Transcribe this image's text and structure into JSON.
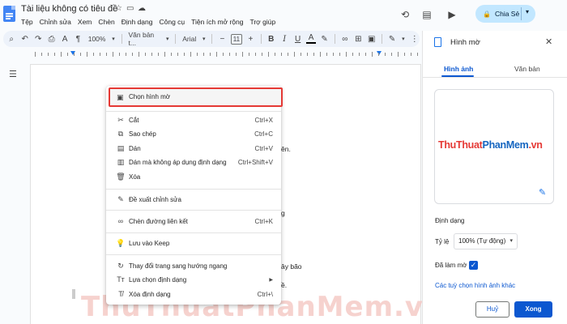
{
  "app": {
    "doc_title": "Tài liệu không có tiêu đề",
    "menus": [
      "Tệp",
      "Chỉnh sửa",
      "Xem",
      "Chèn",
      "Định dạng",
      "Công cụ",
      "Tiện ích mở rộng",
      "Trợ giúp"
    ],
    "share_label": "Chia Sẻ"
  },
  "toolbar": {
    "zoom": "100%",
    "style": "Văn bản t...",
    "font": "Arial",
    "font_size": "11"
  },
  "document": {
    "fragments": [
      "ên.",
      "g",
      "ây bão",
      "ề."
    ],
    "watermark": "ThuThuatPhanMem.vn"
  },
  "context_menu": {
    "highlighted": "Chọn hình mờ",
    "items": [
      {
        "label": "Cắt",
        "shortcut": "Ctrl+X",
        "icon": "scissors-icon"
      },
      {
        "label": "Sao chép",
        "shortcut": "Ctrl+C",
        "icon": "copy-icon"
      },
      {
        "label": "Dán",
        "shortcut": "Ctrl+V",
        "icon": "paste-icon"
      },
      {
        "label": "Dán mà không áp dụng định dạng",
        "shortcut": "Ctrl+Shift+V",
        "icon": "paste-plain-icon"
      },
      {
        "label": "Xóa",
        "shortcut": "",
        "icon": "trash-icon"
      },
      {
        "label": "Đề xuất chỉnh sửa",
        "shortcut": "",
        "icon": "suggest-edit-icon"
      },
      {
        "label": "Chèn đường liên kết",
        "shortcut": "Ctrl+K",
        "icon": "link-icon"
      },
      {
        "label": "Lưu vào Keep",
        "shortcut": "",
        "icon": "keep-icon"
      },
      {
        "label": "Thay đổi trang sang hướng ngang",
        "shortcut": "",
        "icon": "rotate-icon"
      },
      {
        "label": "Lựa chọn định dạng",
        "shortcut": "",
        "icon": "format-icon"
      },
      {
        "label": "Xóa định dạng",
        "shortcut": "Ctrl+\\",
        "icon": "clear-format-icon"
      }
    ]
  },
  "panel": {
    "title": "Hình mờ",
    "tab_image": "Hình ảnh",
    "tab_text": "Văn bản",
    "brand_thu": "ThuThuat",
    "brand_phan": "PhanMem",
    "brand_vn": ".vn",
    "format_heading": "Định dạng",
    "scale_label": "Tỷ lệ",
    "scale_value": "100% (Tự động)",
    "faded_label": "Đã làm mờ",
    "more_options": "Các tuỳ chọn hình ảnh khác",
    "cancel": "Huỷ",
    "done": "Xong"
  },
  "colors": {
    "accent": "#0b57d0",
    "highlight_border": "#e53935",
    "brand_red": "#e53935",
    "brand_blue": "#1565c0"
  }
}
